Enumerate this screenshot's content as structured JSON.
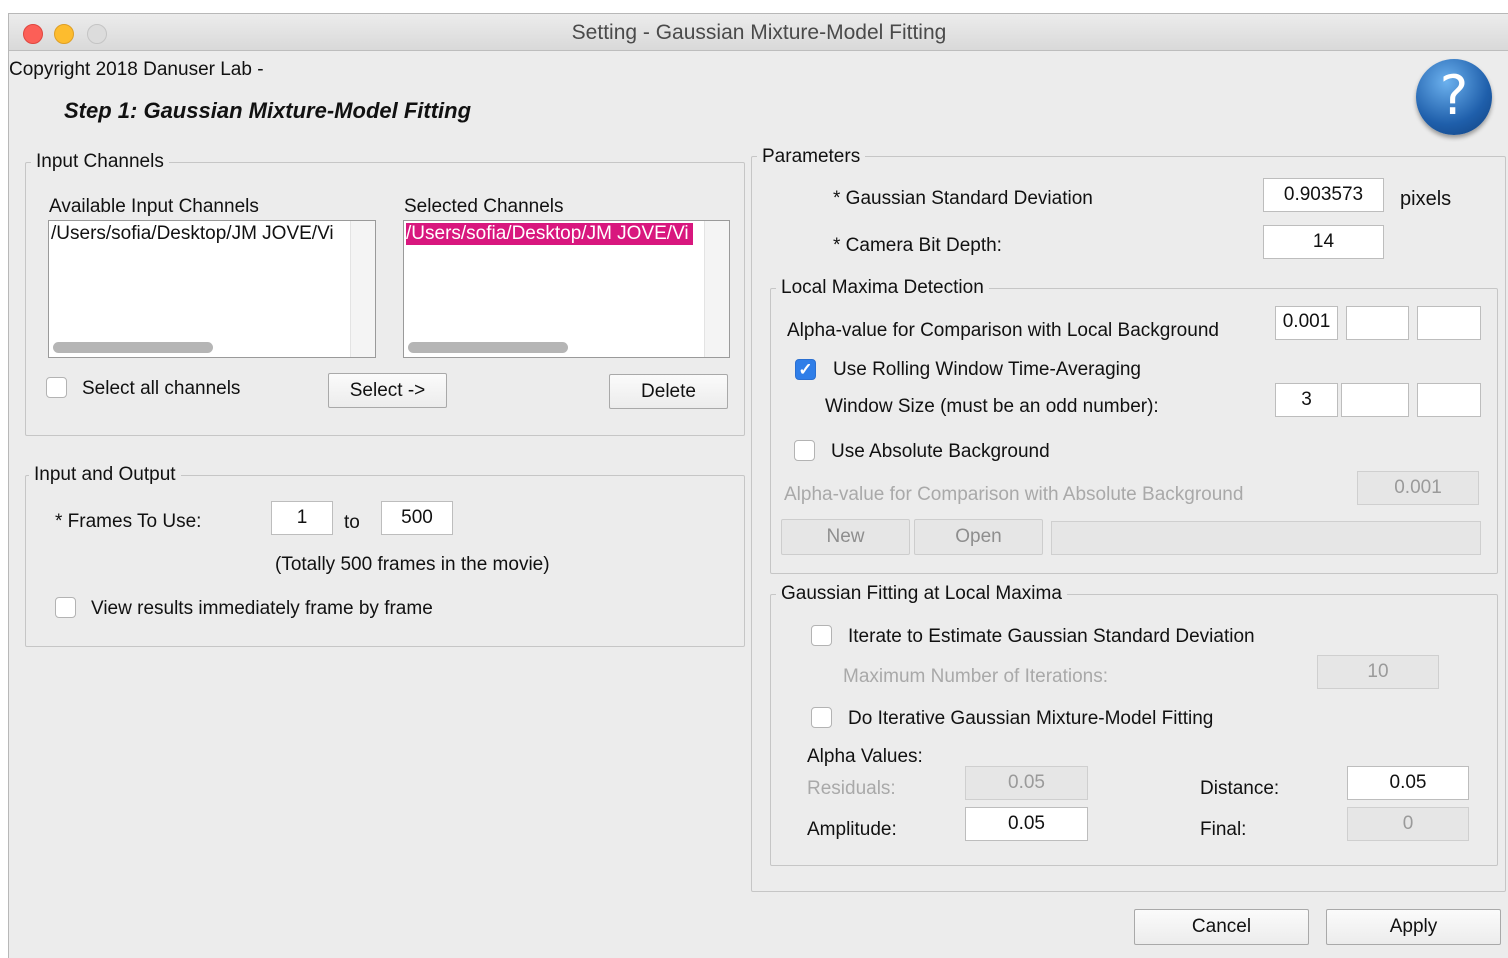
{
  "window": {
    "title": "Setting - Gaussian Mixture-Model Fitting"
  },
  "header": {
    "copyright": "Copyright 2018 Danuser Lab -",
    "step_title": "Step 1: Gaussian Mixture-Model Fitting",
    "help_glyph": "?"
  },
  "input_channels": {
    "legend": "Input Channels",
    "available_label": "Available Input Channels",
    "selected_label": "Selected Channels",
    "available_items": [
      "/Users/sofia/Desktop/JM JOVE/Vi"
    ],
    "selected_items": [
      "/Users/sofia/Desktop/JM JOVE/Vi"
    ],
    "select_all_label": "Select all channels",
    "select_all_checked": false,
    "select_button": "Select ->",
    "delete_button": "Delete"
  },
  "input_output": {
    "legend": "Input and Output",
    "frames_label": "* Frames To Use:",
    "frame_from": "1",
    "to_label": "to",
    "frame_to": "500",
    "total_note": "(Totally 500 frames in the movie)",
    "view_results_label": "View results immediately frame by frame",
    "view_results_checked": false
  },
  "parameters": {
    "legend": "Parameters",
    "gauss_std_label": "* Gaussian Standard Deviation",
    "gauss_std_value": "0.903573",
    "gauss_std_unit": "pixels",
    "bit_depth_label": "* Camera Bit Depth:",
    "bit_depth_value": "14"
  },
  "local_maxima": {
    "legend": "Local Maxima Detection",
    "alpha_local_label": "Alpha-value for Comparison with Local Background",
    "alpha_local_values": [
      "0.001",
      "",
      ""
    ],
    "rolling_label": "Use Rolling Window Time-Averaging",
    "rolling_checked": true,
    "window_label": "Window Size (must be an odd number):",
    "window_values": [
      "3",
      "",
      ""
    ],
    "abs_bg_label": "Use Absolute Background",
    "abs_bg_checked": false,
    "alpha_abs_label": "Alpha-value for Comparison with Absolute Background",
    "alpha_abs_value": "0.001",
    "new_button": "New",
    "open_button": "Open",
    "path_value": ""
  },
  "gaussian_fitting": {
    "legend": "Gaussian Fitting at Local Maxima",
    "iterate_label": "Iterate to Estimate Gaussian Standard Deviation",
    "iterate_checked": false,
    "max_iter_label": "Maximum Number of Iterations:",
    "max_iter_value": "10",
    "iterative_gmm_label": "Do Iterative Gaussian Mixture-Model Fitting",
    "iterative_gmm_checked": false,
    "alpha_values_label": "Alpha Values:",
    "residuals_label": "Residuals:",
    "residuals_value": "0.05",
    "distance_label": "Distance:",
    "distance_value": "0.05",
    "amplitude_label": "Amplitude:",
    "amplitude_value": "0.05",
    "final_label": "Final:",
    "final_value": "0"
  },
  "footer": {
    "cancel_button": "Cancel",
    "apply_button": "Apply"
  },
  "colors": {
    "selection": "#d8177e",
    "checkbox_on": "#2f7ee8",
    "window_bg": "#ececec"
  }
}
